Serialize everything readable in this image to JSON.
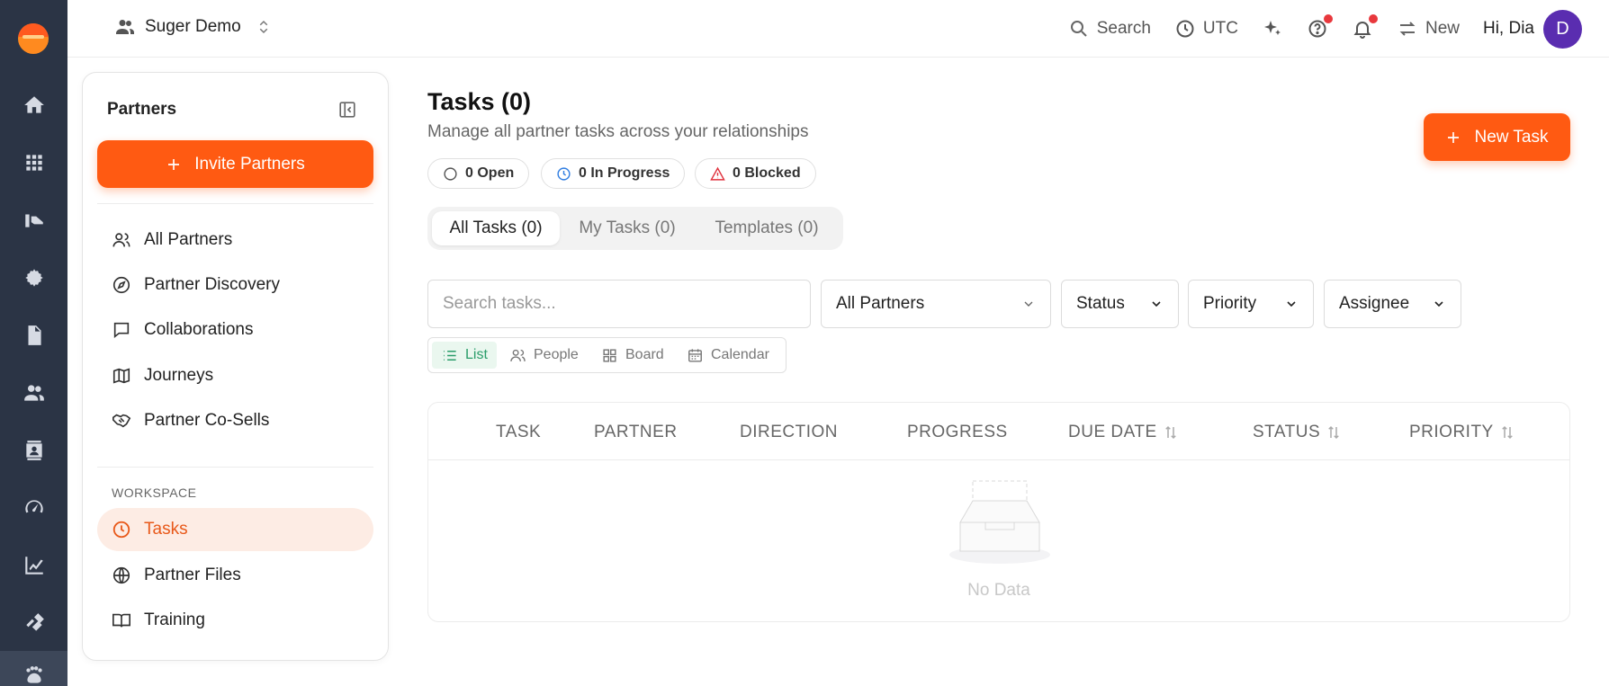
{
  "org": {
    "name": "Suger Demo"
  },
  "topbar": {
    "search_label": "Search",
    "timezone": "UTC",
    "new_label": "New",
    "greeting": "Hi, Dia",
    "avatar_initial": "D"
  },
  "partners_panel": {
    "title": "Partners",
    "invite_label": "Invite Partners",
    "items": [
      {
        "label": "All Partners",
        "icon": "users-icon"
      },
      {
        "label": "Partner Discovery",
        "icon": "compass-icon"
      },
      {
        "label": "Collaborations",
        "icon": "chat-icon"
      },
      {
        "label": "Journeys",
        "icon": "map-icon"
      },
      {
        "label": "Partner Co-Sells",
        "icon": "handshake-icon"
      }
    ],
    "workspace_label": "WORKSPACE",
    "workspace_items": [
      {
        "label": "Tasks",
        "icon": "clock-icon",
        "active": true
      },
      {
        "label": "Partner Files",
        "icon": "globe-icon"
      },
      {
        "label": "Training",
        "icon": "book-icon"
      }
    ]
  },
  "main": {
    "title": "Tasks (0)",
    "subtitle": "Manage all partner tasks across your relationships",
    "new_task_label": "New Task",
    "status_pills": [
      {
        "label": "0 Open",
        "color": "#555555"
      },
      {
        "label": "0 In Progress",
        "color": "#2f7de1"
      },
      {
        "label": "0 Blocked",
        "color": "#e0323d"
      }
    ],
    "tabs": [
      {
        "label": "All Tasks (0)",
        "active": true
      },
      {
        "label": "My Tasks (0)"
      },
      {
        "label": "Templates (0)"
      }
    ],
    "search_placeholder": "Search tasks...",
    "filters": {
      "partner": "All Partners",
      "status": "Status",
      "priority": "Priority",
      "assignee": "Assignee"
    },
    "views": [
      {
        "label": "List",
        "active": true
      },
      {
        "label": "People"
      },
      {
        "label": "Board"
      },
      {
        "label": "Calendar"
      }
    ],
    "table": {
      "columns": [
        "TASK",
        "PARTNER",
        "DIRECTION",
        "PROGRESS",
        "DUE DATE",
        "STATUS",
        "PRIORITY"
      ],
      "empty_text": "No Data"
    }
  },
  "colors": {
    "accent": "#ff5a12",
    "rail": "#2b3445",
    "active_view": "#2a9d6a"
  }
}
